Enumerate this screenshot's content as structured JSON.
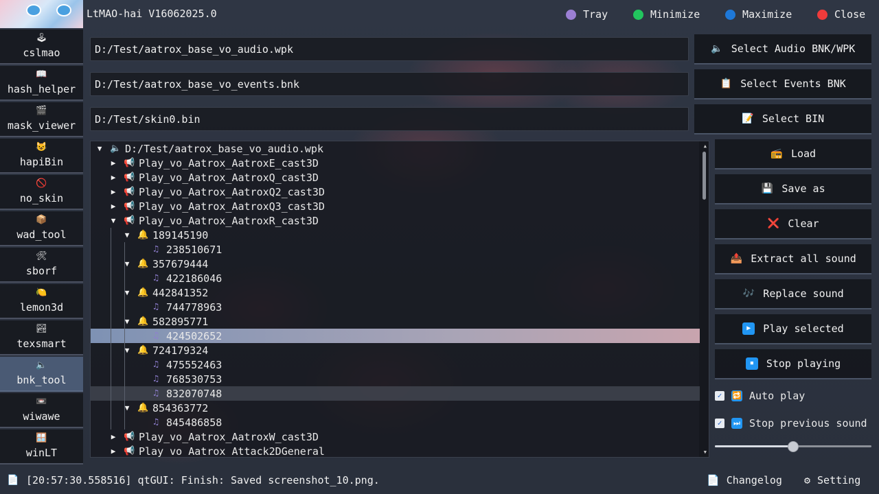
{
  "app": {
    "title": "LtMAO-hai V16062025.0",
    "controls": [
      {
        "label": "Tray",
        "color": "#9b7fd4"
      },
      {
        "label": "Minimize",
        "color": "#22c55e"
      },
      {
        "label": "Maximize",
        "color": "#1e78d8"
      },
      {
        "label": "Close",
        "color": "#ef3b3b"
      }
    ]
  },
  "sidebar": {
    "items": [
      {
        "label": "cslmao",
        "icon": "🕹",
        "active": false
      },
      {
        "label": "hash_helper",
        "icon": "📖",
        "active": false
      },
      {
        "label": "mask_viewer",
        "icon": "🎬",
        "active": false
      },
      {
        "label": "hapiBin",
        "icon": "😺",
        "active": false
      },
      {
        "label": "no_skin",
        "icon": "🚫",
        "active": false
      },
      {
        "label": "wad_tool",
        "icon": "📦",
        "active": false
      },
      {
        "label": "sborf",
        "icon": "🛠",
        "active": false
      },
      {
        "label": "lemon3d",
        "icon": "🍋",
        "active": false
      },
      {
        "label": "texsmart",
        "icon": "🏞",
        "active": false
      },
      {
        "label": "bnk_tool",
        "icon": "🔈",
        "active": true
      },
      {
        "label": "wiwawe",
        "icon": "📼",
        "active": false
      },
      {
        "label": "winLT",
        "icon": "🪟",
        "active": false
      }
    ]
  },
  "paths": {
    "audio": "D:/Test/aatrox_base_vo_audio.wpk",
    "events": "D:/Test/aatrox_base_vo_events.bnk",
    "bin": "D:/Test/skin0.bin"
  },
  "buttons": {
    "select_audio": {
      "label": "Select Audio BNK/WPK",
      "icon": "🔈"
    },
    "select_events": {
      "label": "Select Events BNK",
      "icon": "📋"
    },
    "select_bin": {
      "label": "Select BIN",
      "icon": "📝"
    },
    "load": {
      "label": "Load",
      "icon": "📻"
    },
    "save_as": {
      "label": "Save as",
      "icon": "💾"
    },
    "clear": {
      "label": "Clear",
      "icon": "❌"
    },
    "extract_all": {
      "label": "Extract all sound",
      "icon": "📤"
    },
    "replace": {
      "label": "Replace sound",
      "icon": "🎶"
    },
    "play_selected": {
      "label": "Play selected",
      "icon": "▶"
    },
    "stop_playing": {
      "label": "Stop playing",
      "icon": "⏹"
    }
  },
  "options": {
    "auto_play": {
      "label": "Auto play",
      "checked": true,
      "icon": "🔁"
    },
    "stop_previous": {
      "label": "Stop previous sound",
      "checked": true,
      "icon": "⏭"
    }
  },
  "volume": {
    "level": 0.5
  },
  "tree": [
    {
      "level": 0,
      "text": "D:/Test/aatrox_base_vo_audio.wpk",
      "kind": "file",
      "expanded": true
    },
    {
      "level": 1,
      "text": "Play_vo_Aatrox_AatroxE_cast3D",
      "kind": "event",
      "expanded": false
    },
    {
      "level": 1,
      "text": "Play_vo_Aatrox_AatroxQ_cast3D",
      "kind": "event",
      "expanded": false
    },
    {
      "level": 1,
      "text": "Play_vo_Aatrox_AatroxQ2_cast3D",
      "kind": "event",
      "expanded": false
    },
    {
      "level": 1,
      "text": "Play_vo_Aatrox_AatroxQ3_cast3D",
      "kind": "event",
      "expanded": false
    },
    {
      "level": 1,
      "text": "Play_vo_Aatrox_AatroxR_cast3D",
      "kind": "event",
      "expanded": true
    },
    {
      "level": 2,
      "text": "189145190",
      "kind": "bell",
      "expanded": true
    },
    {
      "level": 3,
      "text": "238510671",
      "kind": "note"
    },
    {
      "level": 2,
      "text": "357679444",
      "kind": "bell",
      "expanded": true
    },
    {
      "level": 3,
      "text": "422186046",
      "kind": "note"
    },
    {
      "level": 2,
      "text": "442841352",
      "kind": "bell",
      "expanded": true
    },
    {
      "level": 3,
      "text": "744778963",
      "kind": "note"
    },
    {
      "level": 2,
      "text": "582895771",
      "kind": "bell",
      "expanded": true
    },
    {
      "level": 3,
      "text": "424502652",
      "kind": "note",
      "selected": true
    },
    {
      "level": 2,
      "text": "724179324",
      "kind": "bell",
      "expanded": true
    },
    {
      "level": 3,
      "text": "475552463",
      "kind": "note"
    },
    {
      "level": 3,
      "text": "768530753",
      "kind": "note"
    },
    {
      "level": 3,
      "text": "832070748",
      "kind": "note",
      "hover": true
    },
    {
      "level": 2,
      "text": "854363772",
      "kind": "bell",
      "expanded": true
    },
    {
      "level": 3,
      "text": "845486858",
      "kind": "note"
    },
    {
      "level": 1,
      "text": "Play_vo_Aatrox_AatroxW_cast3D",
      "kind": "event",
      "expanded": false
    },
    {
      "level": 1,
      "text": "Play_vo_Aatrox_Attack2DGeneral",
      "kind": "event",
      "expanded": false
    }
  ],
  "tree_icons": {
    "file": "🔈",
    "event": "📢",
    "bell": "🔔",
    "note": "♫"
  },
  "status": {
    "icon": "📄",
    "text": "[20:57:30.558516] qtGUI: Finish: Saved screenshot_10.png."
  },
  "footer": {
    "changelog": {
      "label": "Changelog",
      "icon": "📄"
    },
    "setting": {
      "label": "Setting",
      "icon": "⚙"
    }
  }
}
